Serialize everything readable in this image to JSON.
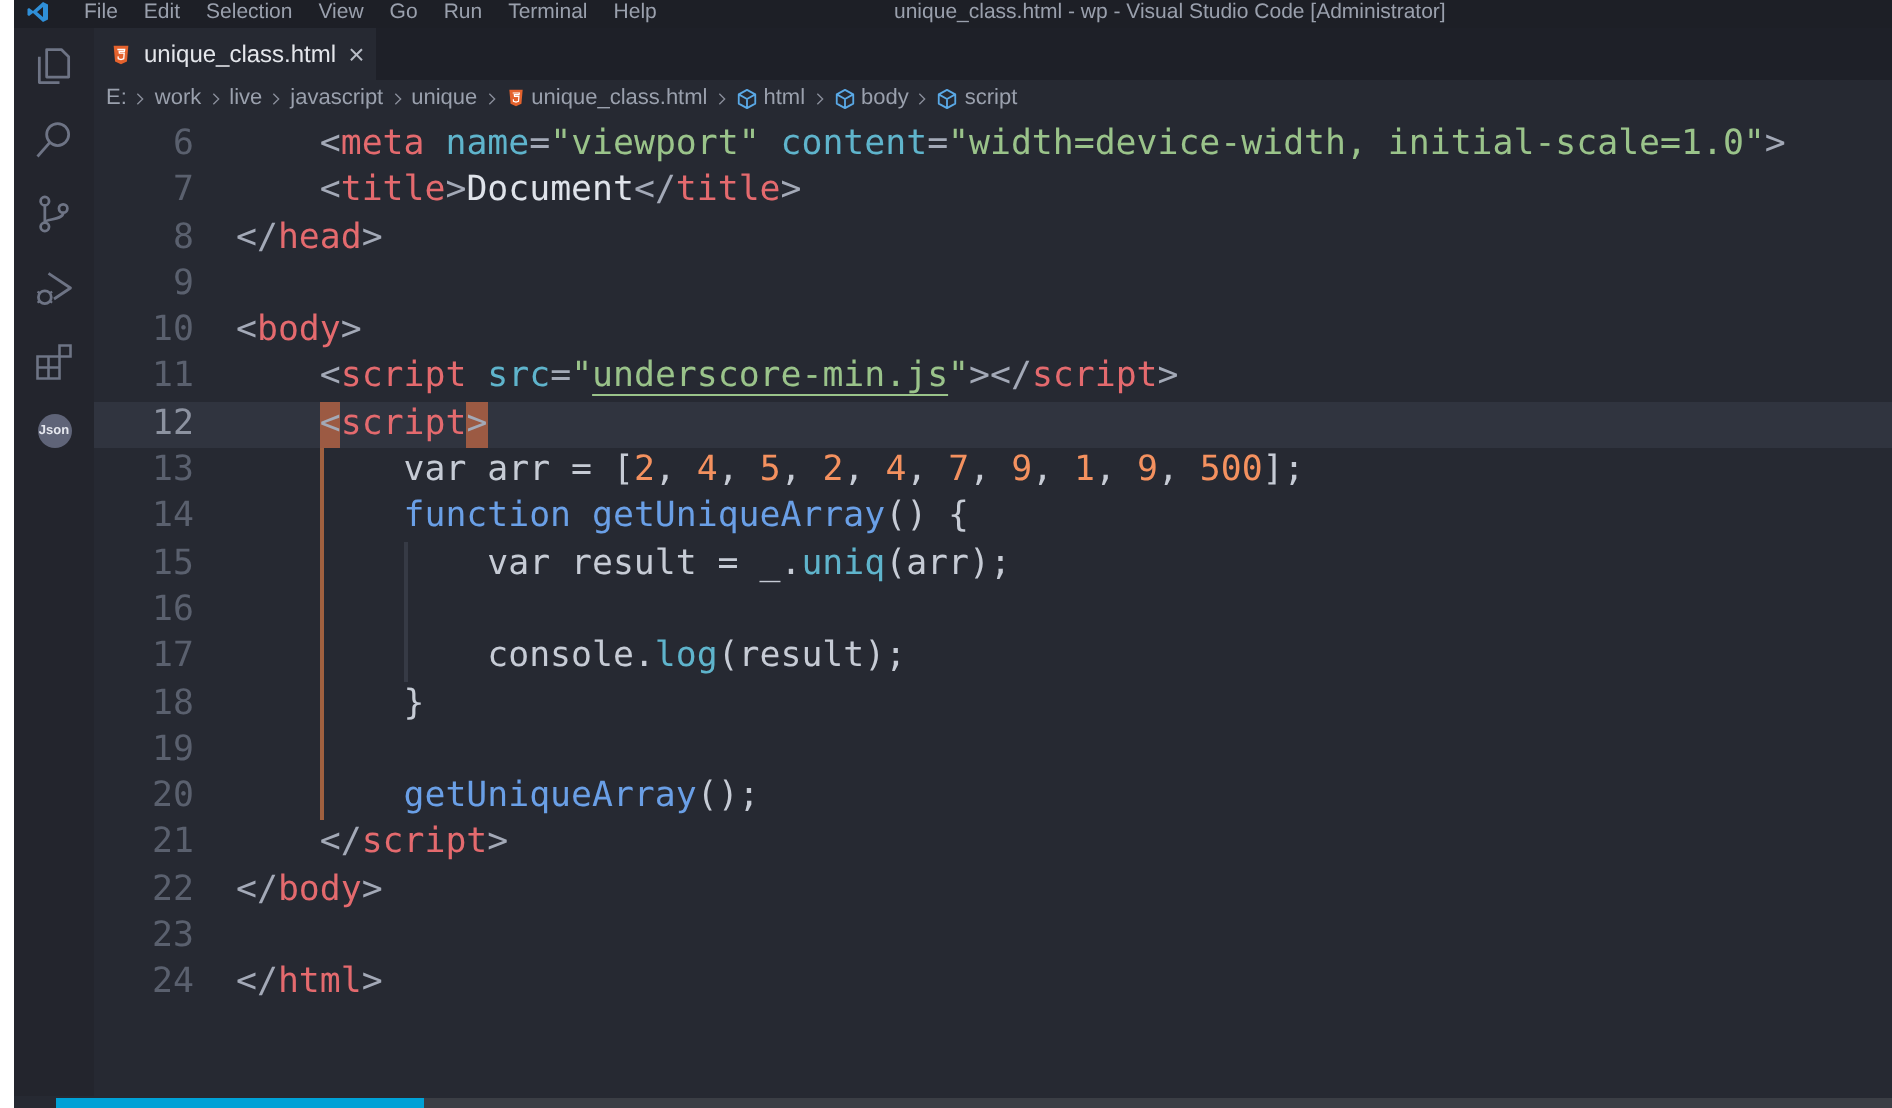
{
  "title_bar": {
    "menu": [
      "File",
      "Edit",
      "Selection",
      "View",
      "Go",
      "Run",
      "Terminal",
      "Help"
    ],
    "title": "unique_class.html - wp - Visual Studio Code [Administrator]"
  },
  "activity_bar": [
    {
      "kind": "files"
    },
    {
      "kind": "search"
    },
    {
      "kind": "source-control"
    },
    {
      "kind": "run-debug"
    },
    {
      "kind": "extensions"
    },
    {
      "kind": "badge",
      "label": "Json"
    }
  ],
  "tabs": [
    {
      "label": "unique_class.html",
      "selected": true,
      "close": "×"
    }
  ],
  "breadcrumb": [
    {
      "label": "E:",
      "kind": "folder"
    },
    {
      "label": "work",
      "kind": "folder"
    },
    {
      "label": "live",
      "kind": "folder"
    },
    {
      "label": "javascript",
      "kind": "folder"
    },
    {
      "label": "unique",
      "kind": "folder"
    },
    {
      "label": "unique_class.html",
      "kind": "html-file"
    },
    {
      "label": "html",
      "kind": "element"
    },
    {
      "label": "body",
      "kind": "element"
    },
    {
      "label": "script",
      "kind": "element"
    }
  ],
  "editor": {
    "lines": [
      {
        "number": "6",
        "current": false,
        "active_guide": false,
        "tokens": [
          {
            "kind": "punct",
            "text": "    <"
          },
          {
            "kind": "tag",
            "text": "meta"
          },
          {
            "kind": "attr",
            "text": " name"
          },
          {
            "kind": "punct",
            "text": "="
          },
          {
            "kind": "str",
            "text": "\"viewport\""
          },
          {
            "kind": "attr",
            "text": " content"
          },
          {
            "kind": "punct",
            "text": "="
          },
          {
            "kind": "str",
            "text": "\"width=device-width, initial-scale=1.0\""
          },
          {
            "kind": "punct",
            "text": ">"
          }
        ]
      },
      {
        "number": "7",
        "current": false,
        "active_guide": false,
        "tokens": [
          {
            "kind": "punct",
            "text": "    <"
          },
          {
            "kind": "tag",
            "text": "title"
          },
          {
            "kind": "punct",
            "text": ">"
          },
          {
            "kind": "text",
            "text": "Document"
          },
          {
            "kind": "punct",
            "text": "</"
          },
          {
            "kind": "tag",
            "text": "title"
          },
          {
            "kind": "punct",
            "text": ">"
          }
        ]
      },
      {
        "number": "8",
        "current": false,
        "active_guide": false,
        "tokens": [
          {
            "kind": "punct",
            "text": "</"
          },
          {
            "kind": "tag",
            "text": "head"
          },
          {
            "kind": "punct",
            "text": ">"
          }
        ]
      },
      {
        "number": "9",
        "current": false,
        "active_guide": false
      },
      {
        "number": "10",
        "current": false,
        "active_guide": false,
        "tokens": [
          {
            "kind": "punct",
            "text": "<"
          },
          {
            "kind": "tag",
            "text": "body"
          },
          {
            "kind": "punct",
            "text": ">"
          }
        ]
      },
      {
        "number": "11",
        "current": false,
        "active_guide": false,
        "tokens": [
          {
            "kind": "punct",
            "text": "    <"
          },
          {
            "kind": "tag",
            "text": "script"
          },
          {
            "kind": "attr",
            "text": " src"
          },
          {
            "kind": "punct",
            "text": "="
          },
          {
            "kind": "str",
            "text": "\""
          },
          {
            "kind": "link",
            "text": "underscore-min.js"
          },
          {
            "kind": "str",
            "text": "\""
          },
          {
            "kind": "punct",
            "text": "></"
          },
          {
            "kind": "tag",
            "text": "script"
          },
          {
            "kind": "punct",
            "text": ">"
          }
        ]
      },
      {
        "number": "12",
        "current": true,
        "active_guide": false,
        "tokens": [
          {
            "kind": "match",
            "text": "    <"
          },
          {
            "kind": "tag",
            "text": "script"
          },
          {
            "kind": "match",
            "text": ">"
          }
        ]
      },
      {
        "number": "13",
        "current": false,
        "active_guide": true,
        "tokens": [
          {
            "kind": "plain",
            "text": "        var arr = ["
          },
          {
            "kind": "num",
            "text": "2"
          },
          {
            "kind": "plain",
            "text": ", "
          },
          {
            "kind": "num",
            "text": "4"
          },
          {
            "kind": "plain",
            "text": ", "
          },
          {
            "kind": "num",
            "text": "5"
          },
          {
            "kind": "plain",
            "text": ", "
          },
          {
            "kind": "num",
            "text": "2"
          },
          {
            "kind": "plain",
            "text": ", "
          },
          {
            "kind": "num",
            "text": "4"
          },
          {
            "kind": "plain",
            "text": ", "
          },
          {
            "kind": "num",
            "text": "7"
          },
          {
            "kind": "plain",
            "text": ", "
          },
          {
            "kind": "num",
            "text": "9"
          },
          {
            "kind": "plain",
            "text": ", "
          },
          {
            "kind": "num",
            "text": "1"
          },
          {
            "kind": "plain",
            "text": ", "
          },
          {
            "kind": "num",
            "text": "9"
          },
          {
            "kind": "plain",
            "text": ", "
          },
          {
            "kind": "num",
            "text": "500"
          },
          {
            "kind": "plain",
            "text": "];"
          }
        ]
      },
      {
        "number": "14",
        "current": false,
        "active_guide": true,
        "tokens": [
          {
            "kind": "kw",
            "text": "        function"
          },
          {
            "kind": "fn",
            "text": " getUniqueArray"
          },
          {
            "kind": "plain",
            "text": "() {"
          }
        ]
      },
      {
        "number": "15",
        "current": false,
        "active_guide": true,
        "tokens": [
          {
            "kind": "plain",
            "text": "            var result = _."
          },
          {
            "kind": "method",
            "text": "uniq"
          },
          {
            "kind": "plain",
            "text": "(arr);"
          }
        ]
      },
      {
        "number": "16",
        "current": false,
        "active_guide": true
      },
      {
        "number": "17",
        "current": false,
        "active_guide": true,
        "tokens": [
          {
            "kind": "plain",
            "text": "            console."
          },
          {
            "kind": "method",
            "text": "log"
          },
          {
            "kind": "plain",
            "text": "(result);"
          }
        ]
      },
      {
        "number": "18",
        "current": false,
        "active_guide": true,
        "tokens": [
          {
            "kind": "plain",
            "text": "        }"
          }
        ]
      },
      {
        "number": "19",
        "current": false,
        "active_guide": true
      },
      {
        "number": "20",
        "current": false,
        "active_guide": true,
        "tokens": [
          {
            "kind": "fn",
            "text": "        getUniqueArray"
          },
          {
            "kind": "plain",
            "text": "();"
          }
        ]
      },
      {
        "number": "21",
        "current": false,
        "active_guide": false,
        "tokens": [
          {
            "kind": "punct",
            "text": "    </"
          },
          {
            "kind": "tag",
            "text": "script"
          },
          {
            "kind": "punct",
            "text": ">"
          }
        ]
      },
      {
        "number": "22",
        "current": false,
        "active_guide": false,
        "tokens": [
          {
            "kind": "punct",
            "text": "</"
          },
          {
            "kind": "tag",
            "text": "body"
          },
          {
            "kind": "punct",
            "text": ">"
          }
        ]
      },
      {
        "number": "23",
        "current": false,
        "active_guide": false
      },
      {
        "number": "24",
        "current": false,
        "active_guide": false,
        "tokens": [
          {
            "kind": "punct",
            "text": "</"
          },
          {
            "kind": "tag",
            "text": "html"
          },
          {
            "kind": "punct",
            "text": ">"
          }
        ]
      }
    ]
  },
  "video_progress": {
    "level": 0.2
  }
}
